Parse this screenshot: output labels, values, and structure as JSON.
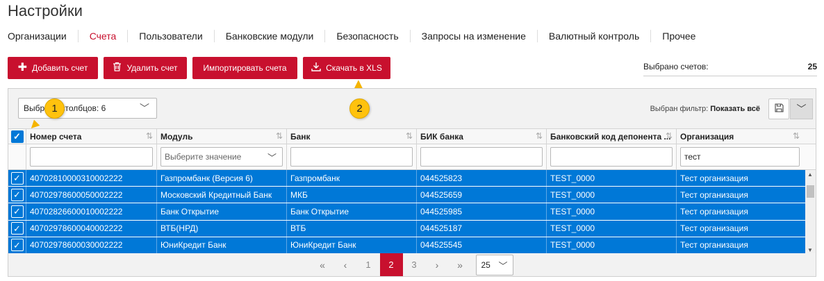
{
  "page_title": "Настройки",
  "tabs": [
    {
      "label": "Организации",
      "active": false
    },
    {
      "label": "Счета",
      "active": true
    },
    {
      "label": "Пользователи",
      "active": false
    },
    {
      "label": "Банковские модули",
      "active": false
    },
    {
      "label": "Безопасность",
      "active": false
    },
    {
      "label": "Запросы на изменение",
      "active": false
    },
    {
      "label": "Валютный контроль",
      "active": false
    },
    {
      "label": "Прочее",
      "active": false
    }
  ],
  "toolbar": {
    "add_label": "Добавить счет",
    "delete_label": "Удалить счет",
    "import_label": "Импортировать счета",
    "export_label": "Скачать в XLS"
  },
  "selected": {
    "label": "Выбрано счетов:",
    "value": "25"
  },
  "columns_select": {
    "value": "Выбрано столбцов: 6"
  },
  "filter": {
    "prefix": "Выбран фильтр:",
    "value": "Показать всё"
  },
  "grid": {
    "headers": [
      "Номер счета",
      "Модуль",
      "Банк",
      "БИК банка",
      "Банковский код депонента ...",
      "Организация"
    ],
    "filters": {
      "account": "",
      "module_placeholder": "Выберите значение",
      "bank": "",
      "bik": "",
      "depo": "",
      "org": "тест"
    },
    "rows": [
      {
        "account": "40702810000310002222",
        "module": "Газпромбанк (Версия 6)",
        "bank": "Газпромбанк",
        "bik": "044525823",
        "depo": "TEST_0000",
        "org": "Тест организация"
      },
      {
        "account": "40702978600050002222",
        "module": "Московский Кредитный Банк",
        "bank": "МКБ",
        "bik": "044525659",
        "depo": "TEST_0000",
        "org": "Тест организация"
      },
      {
        "account": "40702826600010002222",
        "module": "Банк Открытие",
        "bank": "Банк Открытие",
        "bik": "044525985",
        "depo": "TEST_0000",
        "org": "Тест организация"
      },
      {
        "account": "40702978600040002222",
        "module": "ВТБ(НРД)",
        "bank": "ВТБ",
        "bik": "044525187",
        "depo": "TEST_0000",
        "org": "Тест организация"
      },
      {
        "account": "40702978600030002222",
        "module": "ЮниКредит Банк",
        "bank": "ЮниКредит Банк",
        "bik": "044525545",
        "depo": "TEST_0000",
        "org": "Тест организация"
      }
    ]
  },
  "pager": {
    "first": "«",
    "prev": "‹",
    "pages": [
      "1",
      "2",
      "3"
    ],
    "current": "2",
    "next": "›",
    "last": "»",
    "page_size": "25"
  },
  "markers": [
    "1",
    "2"
  ],
  "colors": {
    "brand": "#c8102e",
    "selection": "#0078d7",
    "marker": "#ffc20e"
  }
}
